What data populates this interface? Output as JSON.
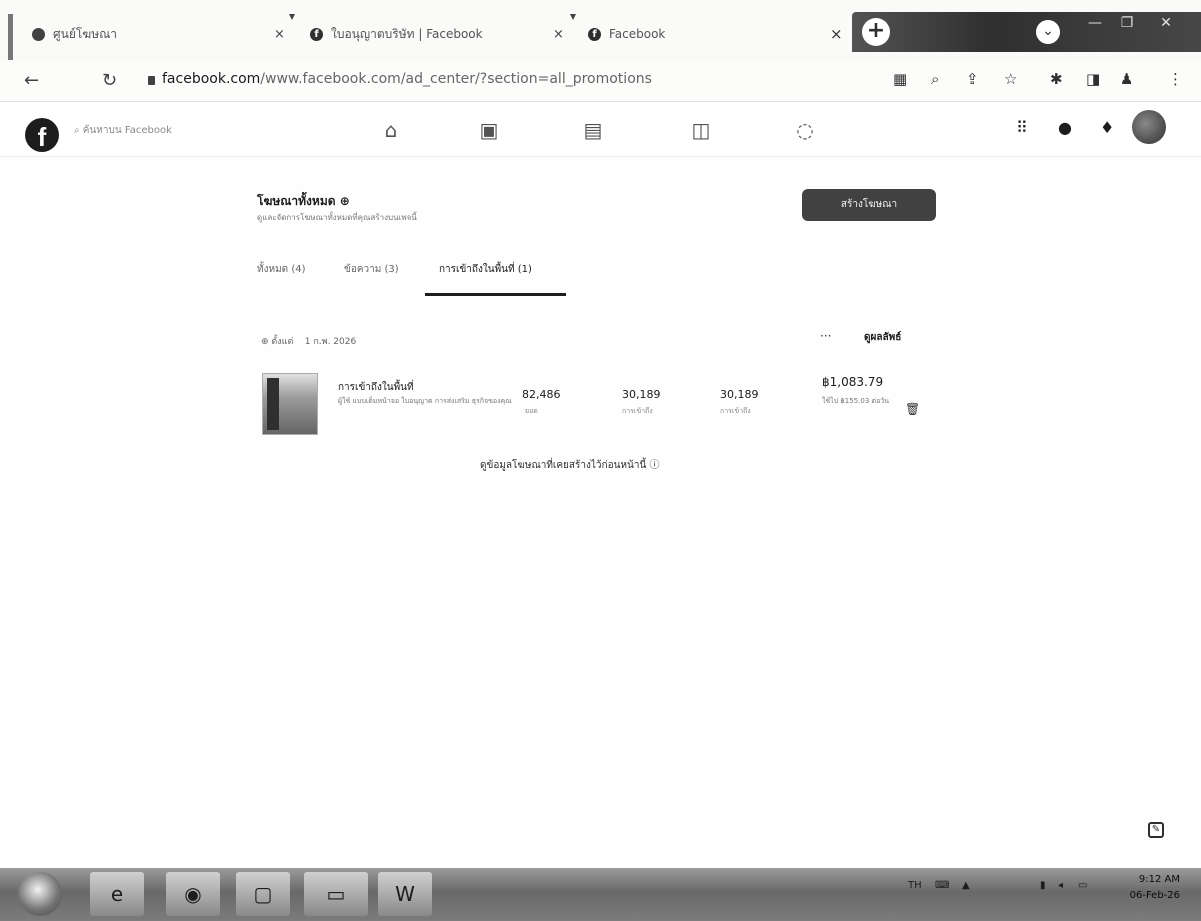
{
  "browser": {
    "tabs": [
      {
        "title": "ศูนย์โฆษณา"
      },
      {
        "title": "ใบอนุญาตบริษัท | Facebook"
      },
      {
        "title": "Facebook"
      }
    ],
    "url_domain": "facebook.com",
    "url_path": "/www.facebook.com/ad_center/?section=all_promotions"
  },
  "facebook": {
    "logo": "f",
    "search_placeholder": "ค้นหาบน Facebook"
  },
  "ad_center": {
    "title": "โฆษณาทั้งหมด ⊕",
    "subtitle": "ดูและจัดการโฆษณาทั้งหมดที่คุณสร้างบนเพจนี้",
    "create_button": "สร้างโฆษณา",
    "tabs": [
      {
        "label": "ทั้งหมด (4)"
      },
      {
        "label": "ข้อความ (3)"
      },
      {
        "label": "การเข้าถึงในพื้นที่ (1)"
      }
    ],
    "filter_label": "⊕ ตั้งแต่",
    "filter_date": "1 ก.พ. 2026",
    "more": "···",
    "see_results": "ดูผลลัพธ์",
    "ad": {
      "title": "การเข้าถึงในพื้นที่",
      "description": "ผู้ใช้ แบบเต็มหน้าจอ ใบอนุญาต การส่งเสริม ธุรกิจของคุณ",
      "metrics": [
        {
          "value": "82,486",
          "label": "ยอด"
        },
        {
          "value": "30,189",
          "label": "การเข้าถึง"
        },
        {
          "value": "30,189",
          "label": "การเข้าถึง"
        }
      ],
      "amount": "฿1,083.79",
      "amount_sub": "ใช้ไป ฿155.03 ต่อวัน"
    },
    "find_link": "ดูข้อมูลโฆษณาที่เคยสร้างไว้ก่อนหน้านี้ ⓘ"
  },
  "taskbar": {
    "tray_lang": "TH",
    "time": "9:12 AM",
    "date": "06-Feb-26"
  }
}
